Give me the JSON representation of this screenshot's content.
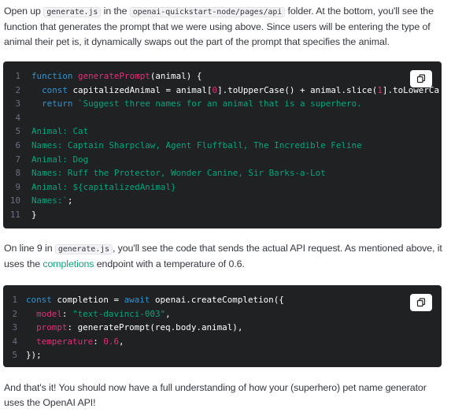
{
  "paragraph1": {
    "t1": "Open up ",
    "c1": "generate.js",
    "t2": " in the ",
    "c2": "openai-quickstart-node/pages/api",
    "t3": " folder. At the bottom, you'll see the function that generates the prompt that we were using above. Since users will be entering the type of animal their pet is, it dynamically swaps out the part of the prompt that specifies the animal."
  },
  "code_block_1": {
    "lines": [
      {
        "n": "1",
        "segs": [
          [
            "kw",
            "function "
          ],
          [
            "fn",
            "generatePrompt"
          ],
          [
            "pl",
            "(animal) {"
          ]
        ]
      },
      {
        "n": "2",
        "segs": [
          [
            "kw",
            "  const "
          ],
          [
            "pl",
            "capitalizedAnimal = animal["
          ],
          [
            "nm",
            "0"
          ],
          [
            "pl",
            "].toUpperCase() + animal.slice("
          ],
          [
            "nm",
            "1"
          ],
          [
            "pl",
            "].toLowerCa"
          ]
        ]
      },
      {
        "n": "3",
        "segs": [
          [
            "kw",
            "  return "
          ],
          [
            "str",
            "`Suggest three names for an animal that is a superhero."
          ]
        ]
      },
      {
        "n": "4",
        "segs": []
      },
      {
        "n": "5",
        "segs": [
          [
            "str",
            "Animal: Cat"
          ]
        ]
      },
      {
        "n": "6",
        "segs": [
          [
            "str",
            "Names: Captain Sharpclaw, Agent Fluffball, The Incredible Feline"
          ]
        ]
      },
      {
        "n": "7",
        "segs": [
          [
            "str",
            "Animal: Dog"
          ]
        ]
      },
      {
        "n": "8",
        "segs": [
          [
            "str",
            "Names: Ruff the Protector, Wonder Canine, Sir Barks-a-Lot"
          ]
        ]
      },
      {
        "n": "9",
        "segs": [
          [
            "str",
            "Animal: ${capitalizedAnimal}"
          ]
        ]
      },
      {
        "n": "10",
        "segs": [
          [
            "str",
            "Names:`"
          ],
          [
            "pl",
            ";"
          ]
        ]
      },
      {
        "n": "11",
        "segs": [
          [
            "pl",
            "}"
          ]
        ]
      }
    ]
  },
  "paragraph2": {
    "t1": "On line 9 in ",
    "c1": "generate.js",
    "t2": ", you'll see the code that sends the actual API request. As mentioned above, it uses the ",
    "link": "completions",
    "t3": " endpoint with a temperature of 0.6."
  },
  "code_block_2": {
    "lines": [
      {
        "n": "1",
        "segs": [
          [
            "kw",
            "const "
          ],
          [
            "pl",
            "completion = "
          ],
          [
            "kw",
            "await "
          ],
          [
            "pl",
            "openai.createCompletion({"
          ]
        ]
      },
      {
        "n": "2",
        "segs": [
          [
            "prop",
            "  model"
          ],
          [
            "pl",
            ": "
          ],
          [
            "str",
            "\"text-davinci-003\""
          ],
          [
            "pl",
            ","
          ]
        ]
      },
      {
        "n": "3",
        "segs": [
          [
            "prop",
            "  prompt"
          ],
          [
            "pl",
            ": generatePrompt(req.body.animal),"
          ]
        ]
      },
      {
        "n": "4",
        "segs": [
          [
            "prop",
            "  temperature"
          ],
          [
            "pl",
            ": "
          ],
          [
            "nm",
            "0.6"
          ],
          [
            "pl",
            ","
          ]
        ]
      },
      {
        "n": "5",
        "segs": [
          [
            "pl",
            "});"
          ]
        ]
      }
    ]
  },
  "paragraph3": {
    "text": "And that's it! You should now have a full understanding of how your (superhero) pet name generator uses the OpenAI API!"
  },
  "icons": {
    "copy": "copy-icon"
  },
  "colors": {
    "code_bg": "#202123",
    "keyword": "#2e95d3",
    "string": "#00a67d",
    "number": "#df3079",
    "link": "#10a37f"
  }
}
